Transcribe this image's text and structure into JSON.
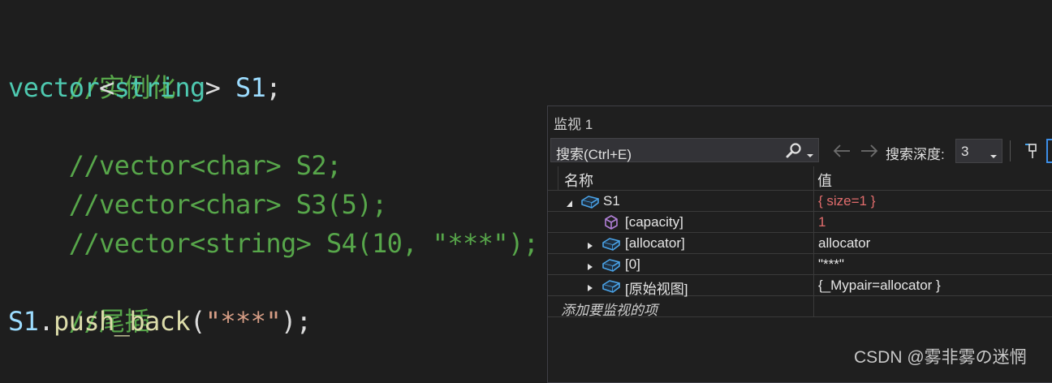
{
  "editor": {
    "lines": {
      "l1": {
        "comment": "//实例化"
      },
      "l2": {
        "type": "vector",
        "lt": "<",
        "targ": "string",
        "gt": ">",
        "sp": " ",
        "var": "S1",
        "semi": ";"
      },
      "l3": {
        "comment": "//vector<char> S2;"
      },
      "l4": {
        "comment": "//vector<char> S3(5);"
      },
      "l5": {
        "comment": "//vector<string> S4(10, \"***\");"
      },
      "l6": {
        "comment": "//尾插"
      },
      "l7": {
        "var": "S1",
        "dot": ".",
        "func": "push_back",
        "open": "(",
        "str": "\"***\"",
        "close": ");"
      }
    }
  },
  "watch": {
    "title": "监视 1",
    "search_placeholder": "搜索(Ctrl+E)",
    "depth_label": "搜索深度:",
    "depth_value": "3",
    "columns": {
      "name": "名称",
      "value": "值"
    },
    "rows": [
      {
        "name": "S1",
        "value": "{ size=1 }",
        "expander": "expanded",
        "icon": "object-icon",
        "changed": true
      },
      {
        "name": "[capacity]",
        "value": "1",
        "expander": "none",
        "icon": "property-icon",
        "changed": true
      },
      {
        "name": "[allocator]",
        "value": "allocator",
        "expander": "collapsed",
        "icon": "object-icon",
        "changed": false
      },
      {
        "name": "[0]",
        "value": "\"***\"",
        "expander": "collapsed",
        "icon": "object-icon",
        "changed": false
      },
      {
        "name": "[原始视图]",
        "value": "{_Mypair=allocator }",
        "expander": "collapsed",
        "icon": "object-icon",
        "changed": false
      }
    ],
    "add_item_text": "添加要监视的项"
  },
  "watermark": "CSDN @雾非雾の迷惘",
  "colors": {
    "background": "#1e1e1e",
    "comment": "#57a64a",
    "type": "#4ec9b0",
    "variable": "#9cdcfe",
    "function": "#dcdcaa",
    "string": "#d69d85",
    "changed_value": "#e06c6c",
    "object_icon": "#4aa3e8",
    "property_icon": "#b180d7"
  }
}
